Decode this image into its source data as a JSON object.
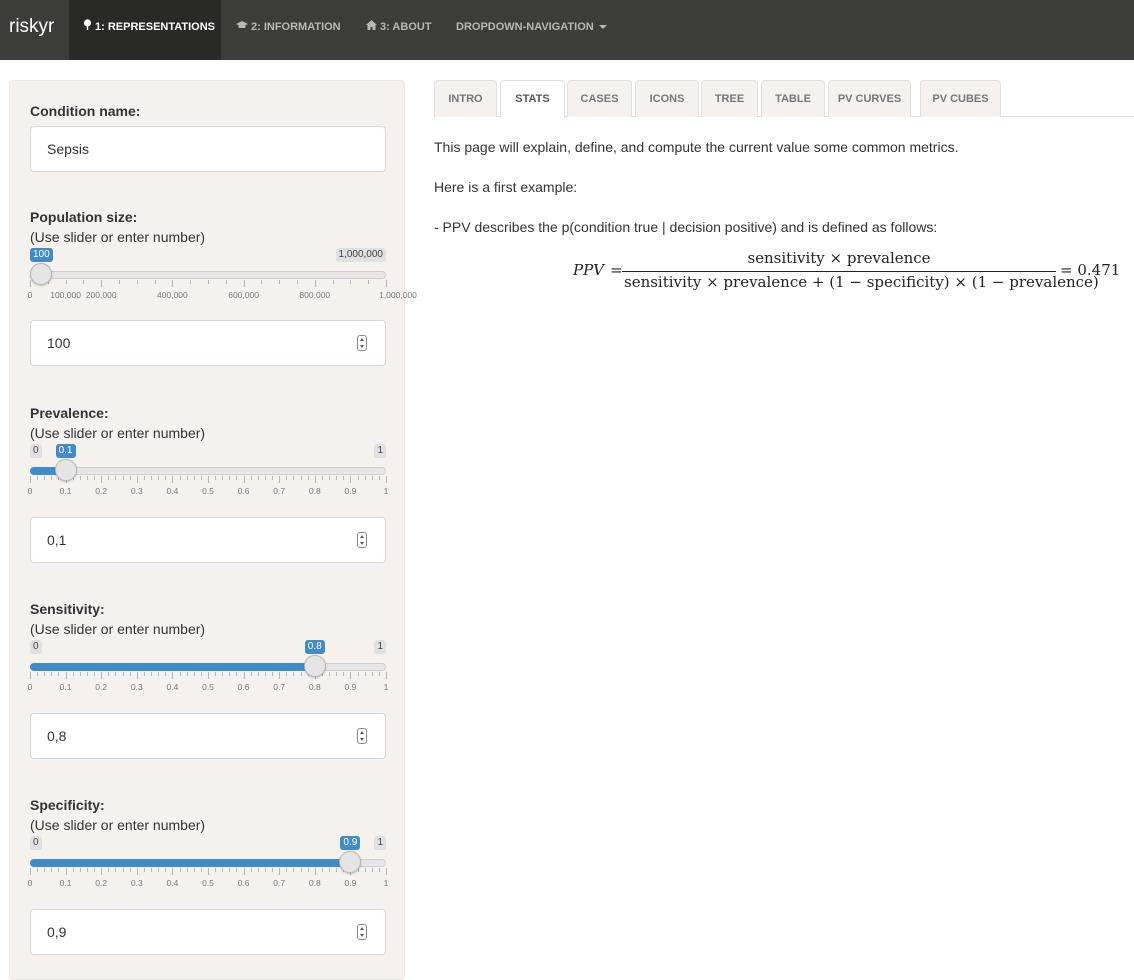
{
  "navbar": {
    "brand": "riskyr",
    "items": [
      {
        "icon": "tree-icon",
        "label": "1: REPRESENTATIONS",
        "active": true
      },
      {
        "icon": "graduation-cap-icon",
        "label": "2: INFORMATION",
        "active": false
      },
      {
        "icon": "home-icon",
        "label": "3: ABOUT",
        "active": false
      },
      {
        "icon": "caret-down-icon",
        "label": "DROPDOWN-NAVIGATION",
        "active": false
      }
    ]
  },
  "sidebar": {
    "condition": {
      "label": "Condition name:",
      "value": "Sepsis"
    },
    "population": {
      "label": "Population size:",
      "hint": "(Use slider or enter number)",
      "min_label": "0",
      "max_label": "1,000,000",
      "value_label": "100",
      "fraction": 0.0001,
      "tick_labels": [
        "0",
        "100,000",
        "200,000",
        "400,000",
        "600,000",
        "800,000",
        "1,000,000"
      ],
      "input_value": "100"
    },
    "prevalence": {
      "label": "Prevalence:",
      "hint": "(Use slider or enter number)",
      "min_label": "0",
      "max_label": "1",
      "value_label": "0.1",
      "fraction": 0.1,
      "tick_labels": [
        "0",
        "0.1",
        "0.2",
        "0.3",
        "0.4",
        "0.5",
        "0.6",
        "0.7",
        "0.8",
        "0.9",
        "1"
      ],
      "input_value": "0,1"
    },
    "sensitivity": {
      "label": "Sensitivity:",
      "hint": "(Use slider or enter number)",
      "min_label": "0",
      "max_label": "1",
      "value_label": "0.8",
      "fraction": 0.8,
      "tick_labels": [
        "0",
        "0.1",
        "0.2",
        "0.3",
        "0.4",
        "0.5",
        "0.6",
        "0.7",
        "0.8",
        "0.9",
        "1"
      ],
      "input_value": "0,8"
    },
    "specificity": {
      "label": "Specificity:",
      "hint": "(Use slider or enter number)",
      "min_label": "0",
      "max_label": "1",
      "value_label": "0.9",
      "fraction": 0.9,
      "tick_labels": [
        "0",
        "0.1",
        "0.2",
        "0.3",
        "0.4",
        "0.5",
        "0.6",
        "0.7",
        "0.8",
        "0.9",
        "1"
      ],
      "input_value": "0,9"
    }
  },
  "tabs": [
    {
      "label": "INTRO",
      "active": false
    },
    {
      "label": "STATS",
      "active": true
    },
    {
      "label": "CASES",
      "active": false
    },
    {
      "label": "ICONS",
      "active": false
    },
    {
      "label": "TREE",
      "active": false
    },
    {
      "label": "TABLE",
      "active": false
    },
    {
      "label": "PV CURVES",
      "active": false
    },
    {
      "label": "PV CUBES",
      "active": false
    }
  ],
  "main": {
    "intro": "This page will explain, define, and compute the current value some common metrics.",
    "example": "Here is a first example:",
    "ppv_desc": "- PPV describes the p(condition true | decision positive) and is defined as follows:",
    "formula": {
      "lhs": "PPV",
      "eq": "=",
      "numerator": "sensitivity × prevalence",
      "denominator": "sensitivity × prevalence + (1 − specificity) × (1 − prevalence)",
      "result": "= 0.471"
    }
  }
}
